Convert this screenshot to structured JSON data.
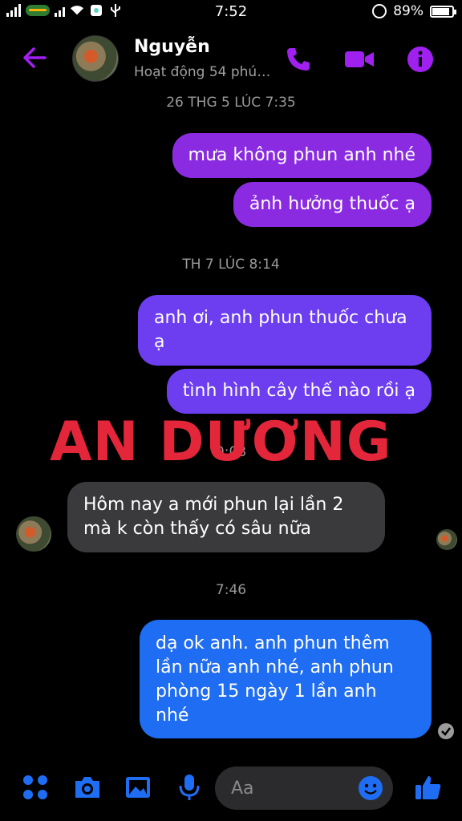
{
  "status_bar": {
    "time": "7:52",
    "battery": "89%"
  },
  "header": {
    "contact_name": "Nguyễn",
    "activity": "Hoạt động 54 phú…"
  },
  "conversation": {
    "timestamps": [
      "26 THG 5 LÚC 7:35",
      "TH 7 LÚC 8:14",
      "0:08",
      "7:46"
    ],
    "messages": [
      {
        "text": "mưa không phun anh nhé",
        "side": "sent"
      },
      {
        "text": "ảnh hưởng thuốc ạ",
        "side": "sent"
      },
      {
        "text": "anh ơi, anh phun thuốc chưa\nạ",
        "side": "sent"
      },
      {
        "text": "tình hình cây thế nào rồi ạ",
        "side": "sent"
      },
      {
        "text": "Hôm nay a mới phun lại lần 2\nmà k còn thấy có sâu nữa",
        "side": "received"
      },
      {
        "text": "dạ ok anh. anh phun thêm\nlần nữa anh nhé, anh phun\nphòng 15 ngày 1 lần anh\nnhé",
        "side": "sent"
      }
    ]
  },
  "watermark": "AN DƯƠNG",
  "composer": {
    "placeholder": "Aa"
  },
  "colors": {
    "accent": "#a020f0",
    "sent_blue": "#1f6df2",
    "received": "#3a3a3c",
    "watermark": "#e3263a"
  },
  "icons": [
    "back-arrow-icon",
    "phone-icon",
    "video-icon",
    "info-icon",
    "apps-icon",
    "camera-icon",
    "gallery-icon",
    "microphone-icon",
    "emoji-icon",
    "thumbs-up-icon"
  ]
}
